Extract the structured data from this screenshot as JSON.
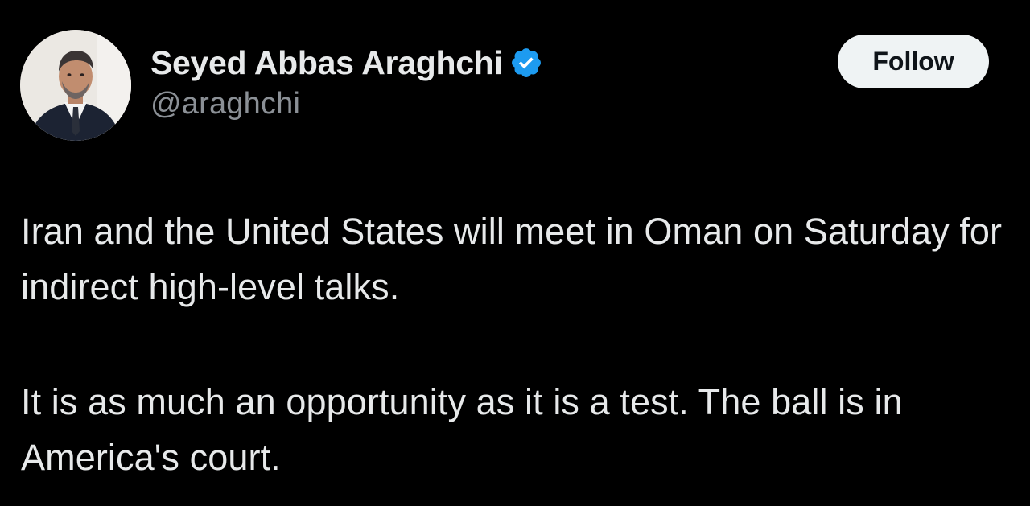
{
  "author": {
    "display_name": "Seyed Abbas Araghchi",
    "handle": "@araghchi",
    "verified": true,
    "avatar_icon": "profile-photo"
  },
  "actions": {
    "follow_label": "Follow"
  },
  "tweet": {
    "paragraphs": [
      "Iran and the United States will meet in Oman on Saturday for indirect high-level talks.",
      "It is as much an opportunity as it is a test. The ball is in America's court."
    ]
  },
  "colors": {
    "background": "#000000",
    "text_primary": "#e7e9ea",
    "text_secondary": "#8b9096",
    "verified_blue": "#1d9bf0",
    "follow_bg": "#eff3f4",
    "follow_text": "#0f1419"
  }
}
